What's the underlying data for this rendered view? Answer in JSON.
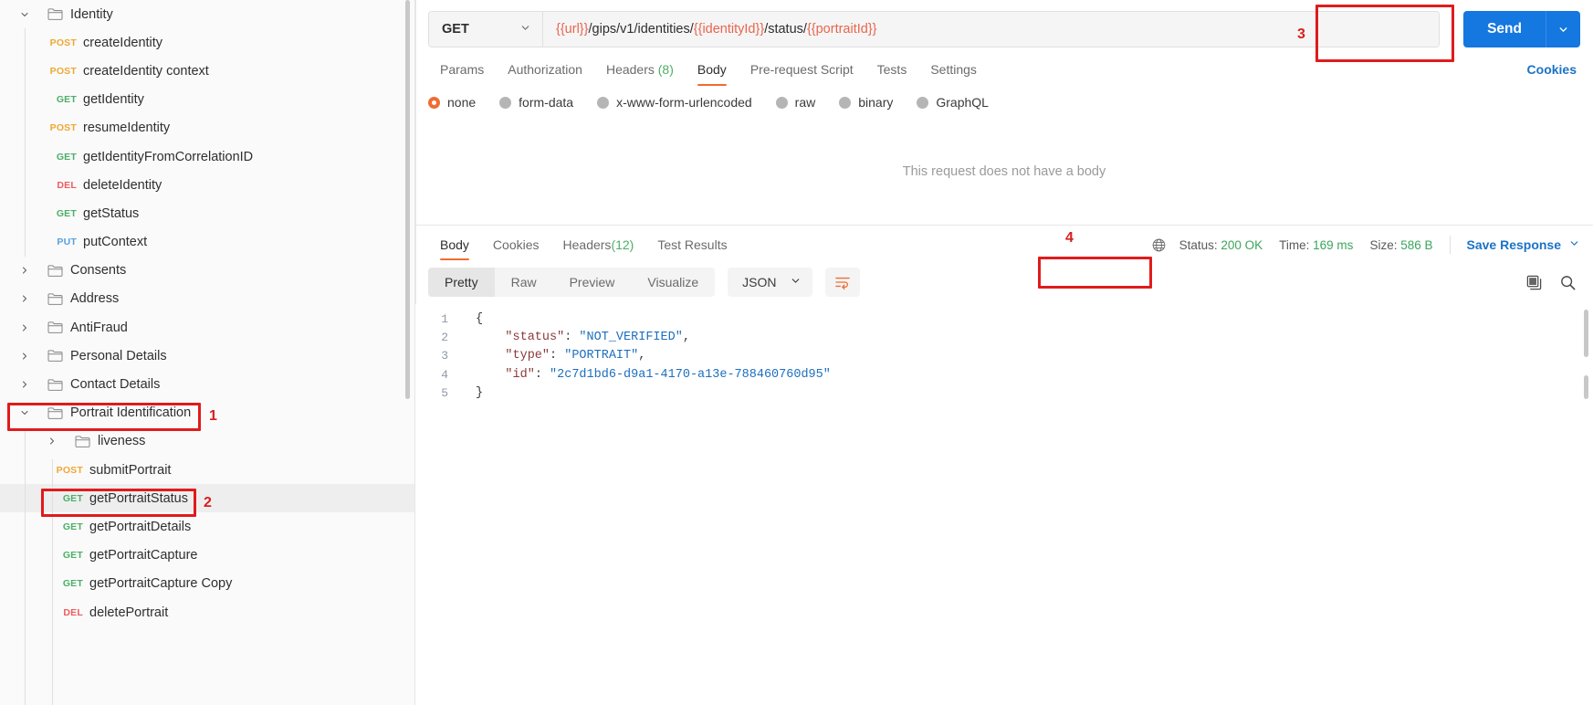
{
  "sidebar": {
    "items": [
      {
        "kind": "folder",
        "label": "Identity",
        "expanded": true,
        "depth": 0
      },
      {
        "kind": "request",
        "method": "POST",
        "label": "createIdentity",
        "depth": 1
      },
      {
        "kind": "request",
        "method": "POST",
        "label": "createIdentity context",
        "depth": 1
      },
      {
        "kind": "request",
        "method": "GET",
        "label": "getIdentity",
        "depth": 1
      },
      {
        "kind": "request",
        "method": "POST",
        "label": "resumeIdentity",
        "depth": 1
      },
      {
        "kind": "request",
        "method": "GET",
        "label": "getIdentityFromCorrelationID",
        "depth": 1
      },
      {
        "kind": "request",
        "method": "DEL",
        "label": "deleteIdentity",
        "depth": 1
      },
      {
        "kind": "request",
        "method": "GET",
        "label": "getStatus",
        "depth": 1
      },
      {
        "kind": "request",
        "method": "PUT",
        "label": "putContext",
        "depth": 1
      },
      {
        "kind": "folder",
        "label": "Consents",
        "expanded": false,
        "depth": 0
      },
      {
        "kind": "folder",
        "label": "Address",
        "expanded": false,
        "depth": 0
      },
      {
        "kind": "folder",
        "label": "AntiFraud",
        "expanded": false,
        "depth": 0
      },
      {
        "kind": "folder",
        "label": "Personal Details",
        "expanded": false,
        "depth": 0
      },
      {
        "kind": "folder",
        "label": "Contact Details",
        "expanded": false,
        "depth": 0
      },
      {
        "kind": "folder",
        "label": "Portrait Identification",
        "expanded": true,
        "depth": 0,
        "highlighted": true
      },
      {
        "kind": "folder",
        "label": "liveness",
        "expanded": false,
        "depth": 1
      },
      {
        "kind": "request",
        "method": "POST",
        "label": "submitPortrait",
        "depth": 2
      },
      {
        "kind": "request",
        "method": "GET",
        "label": "getPortraitStatus",
        "depth": 2,
        "selected": true,
        "highlighted": true
      },
      {
        "kind": "request",
        "method": "GET",
        "label": "getPortraitDetails",
        "depth": 2
      },
      {
        "kind": "request",
        "method": "GET",
        "label": "getPortraitCapture",
        "depth": 2
      },
      {
        "kind": "request",
        "method": "GET",
        "label": "getPortraitCapture Copy",
        "depth": 2
      },
      {
        "kind": "request",
        "method": "DEL",
        "label": "deletePortrait",
        "depth": 2
      }
    ]
  },
  "request": {
    "method": "GET",
    "url_parts": [
      {
        "text": "{{url}}",
        "variable": true
      },
      {
        "text": "/gips/v1/identities/",
        "variable": false
      },
      {
        "text": "{{identityId}}",
        "variable": true
      },
      {
        "text": "/status/",
        "variable": false
      },
      {
        "text": "{{portraitId}}",
        "variable": true
      }
    ],
    "url_full": "{{url}}/gips/v1/identities/{{identityId}}/status/{{portraitId}}",
    "send_label": "Send",
    "cookies_label": "Cookies",
    "tabs": [
      {
        "label": "Params",
        "active": false
      },
      {
        "label": "Authorization",
        "active": false
      },
      {
        "label": "Headers",
        "count": "(8)",
        "active": false
      },
      {
        "label": "Body",
        "active": true
      },
      {
        "label": "Pre-request Script",
        "active": false
      },
      {
        "label": "Tests",
        "active": false
      },
      {
        "label": "Settings",
        "active": false
      }
    ],
    "body_types": [
      {
        "label": "none",
        "selected": true
      },
      {
        "label": "form-data",
        "selected": false
      },
      {
        "label": "x-www-form-urlencoded",
        "selected": false
      },
      {
        "label": "raw",
        "selected": false
      },
      {
        "label": "binary",
        "selected": false
      },
      {
        "label": "GraphQL",
        "selected": false
      }
    ],
    "empty_body_message": "This request does not have a body"
  },
  "response": {
    "tabs": [
      {
        "label": "Body",
        "active": true
      },
      {
        "label": "Cookies",
        "active": false
      },
      {
        "label": "Headers",
        "count": "(12)",
        "active": false
      },
      {
        "label": "Test Results",
        "active": false
      }
    ],
    "status_label": "Status:",
    "status_value": "200 OK",
    "time_label": "Time:",
    "time_value": "169 ms",
    "size_label": "Size:",
    "size_value": "586 B",
    "save_response_label": "Save Response",
    "formats": [
      {
        "label": "Pretty",
        "active": true
      },
      {
        "label": "Raw",
        "active": false
      },
      {
        "label": "Preview",
        "active": false
      },
      {
        "label": "Visualize",
        "active": false
      }
    ],
    "language": "JSON",
    "code_lines": [
      {
        "num": "1",
        "tokens": [
          {
            "t": "{",
            "c": "brace"
          }
        ]
      },
      {
        "num": "2",
        "tokens": [
          {
            "t": "    ",
            "c": "p"
          },
          {
            "t": "\"status\"",
            "c": "k"
          },
          {
            "t": ": ",
            "c": "p"
          },
          {
            "t": "\"NOT_VERIFIED\"",
            "c": "s"
          },
          {
            "t": ",",
            "c": "p"
          }
        ]
      },
      {
        "num": "3",
        "tokens": [
          {
            "t": "    ",
            "c": "p"
          },
          {
            "t": "\"type\"",
            "c": "k"
          },
          {
            "t": ": ",
            "c": "p"
          },
          {
            "t": "\"PORTRAIT\"",
            "c": "s"
          },
          {
            "t": ",",
            "c": "p"
          }
        ]
      },
      {
        "num": "4",
        "tokens": [
          {
            "t": "    ",
            "c": "p"
          },
          {
            "t": "\"id\"",
            "c": "k"
          },
          {
            "t": ": ",
            "c": "p"
          },
          {
            "t": "\"2c7d1bd6-d9a1-4170-a13e-788460760d95\"",
            "c": "s"
          }
        ]
      },
      {
        "num": "5",
        "tokens": [
          {
            "t": "}",
            "c": "brace"
          }
        ]
      }
    ]
  },
  "annotations": [
    {
      "number": "1",
      "target": "portrait-identification-folder"
    },
    {
      "number": "2",
      "target": "get-portrait-status-request"
    },
    {
      "number": "3",
      "target": "send-button"
    },
    {
      "number": "4",
      "target": "status-200-ok"
    }
  ],
  "colors": {
    "accent_orange": "#ef6c33",
    "send_blue": "#1577e0",
    "link_blue": "#1a73c7",
    "success_green": "#3ba55d",
    "annotation_red": "#e01b1b",
    "method_get": "#4caf68",
    "method_post": "#f0a733",
    "method_del": "#ef5b5b",
    "method_put": "#57a0e0"
  }
}
